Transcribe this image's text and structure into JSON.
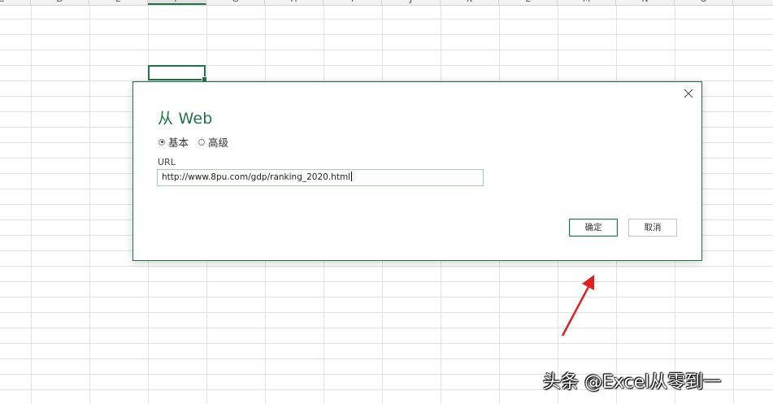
{
  "spreadsheet": {
    "column_headers": [
      "C",
      "D",
      "E",
      "F",
      "G",
      "H",
      "I",
      "J",
      "K",
      "L",
      "M",
      "N",
      "O"
    ],
    "active_column": "F"
  },
  "dialog": {
    "title": "从 Web",
    "radio_basic": "基本",
    "radio_advanced": "高级",
    "selected_mode": "基本",
    "url_label": "URL",
    "url_value": "http://www.8pu.com/gdp/ranking_2020.html",
    "ok_label": "确定",
    "cancel_label": "取消",
    "accent_color": "#217346"
  },
  "annotation": {
    "arrow_color": "#e02020",
    "watermark": "头条 @Excel从零到一"
  }
}
